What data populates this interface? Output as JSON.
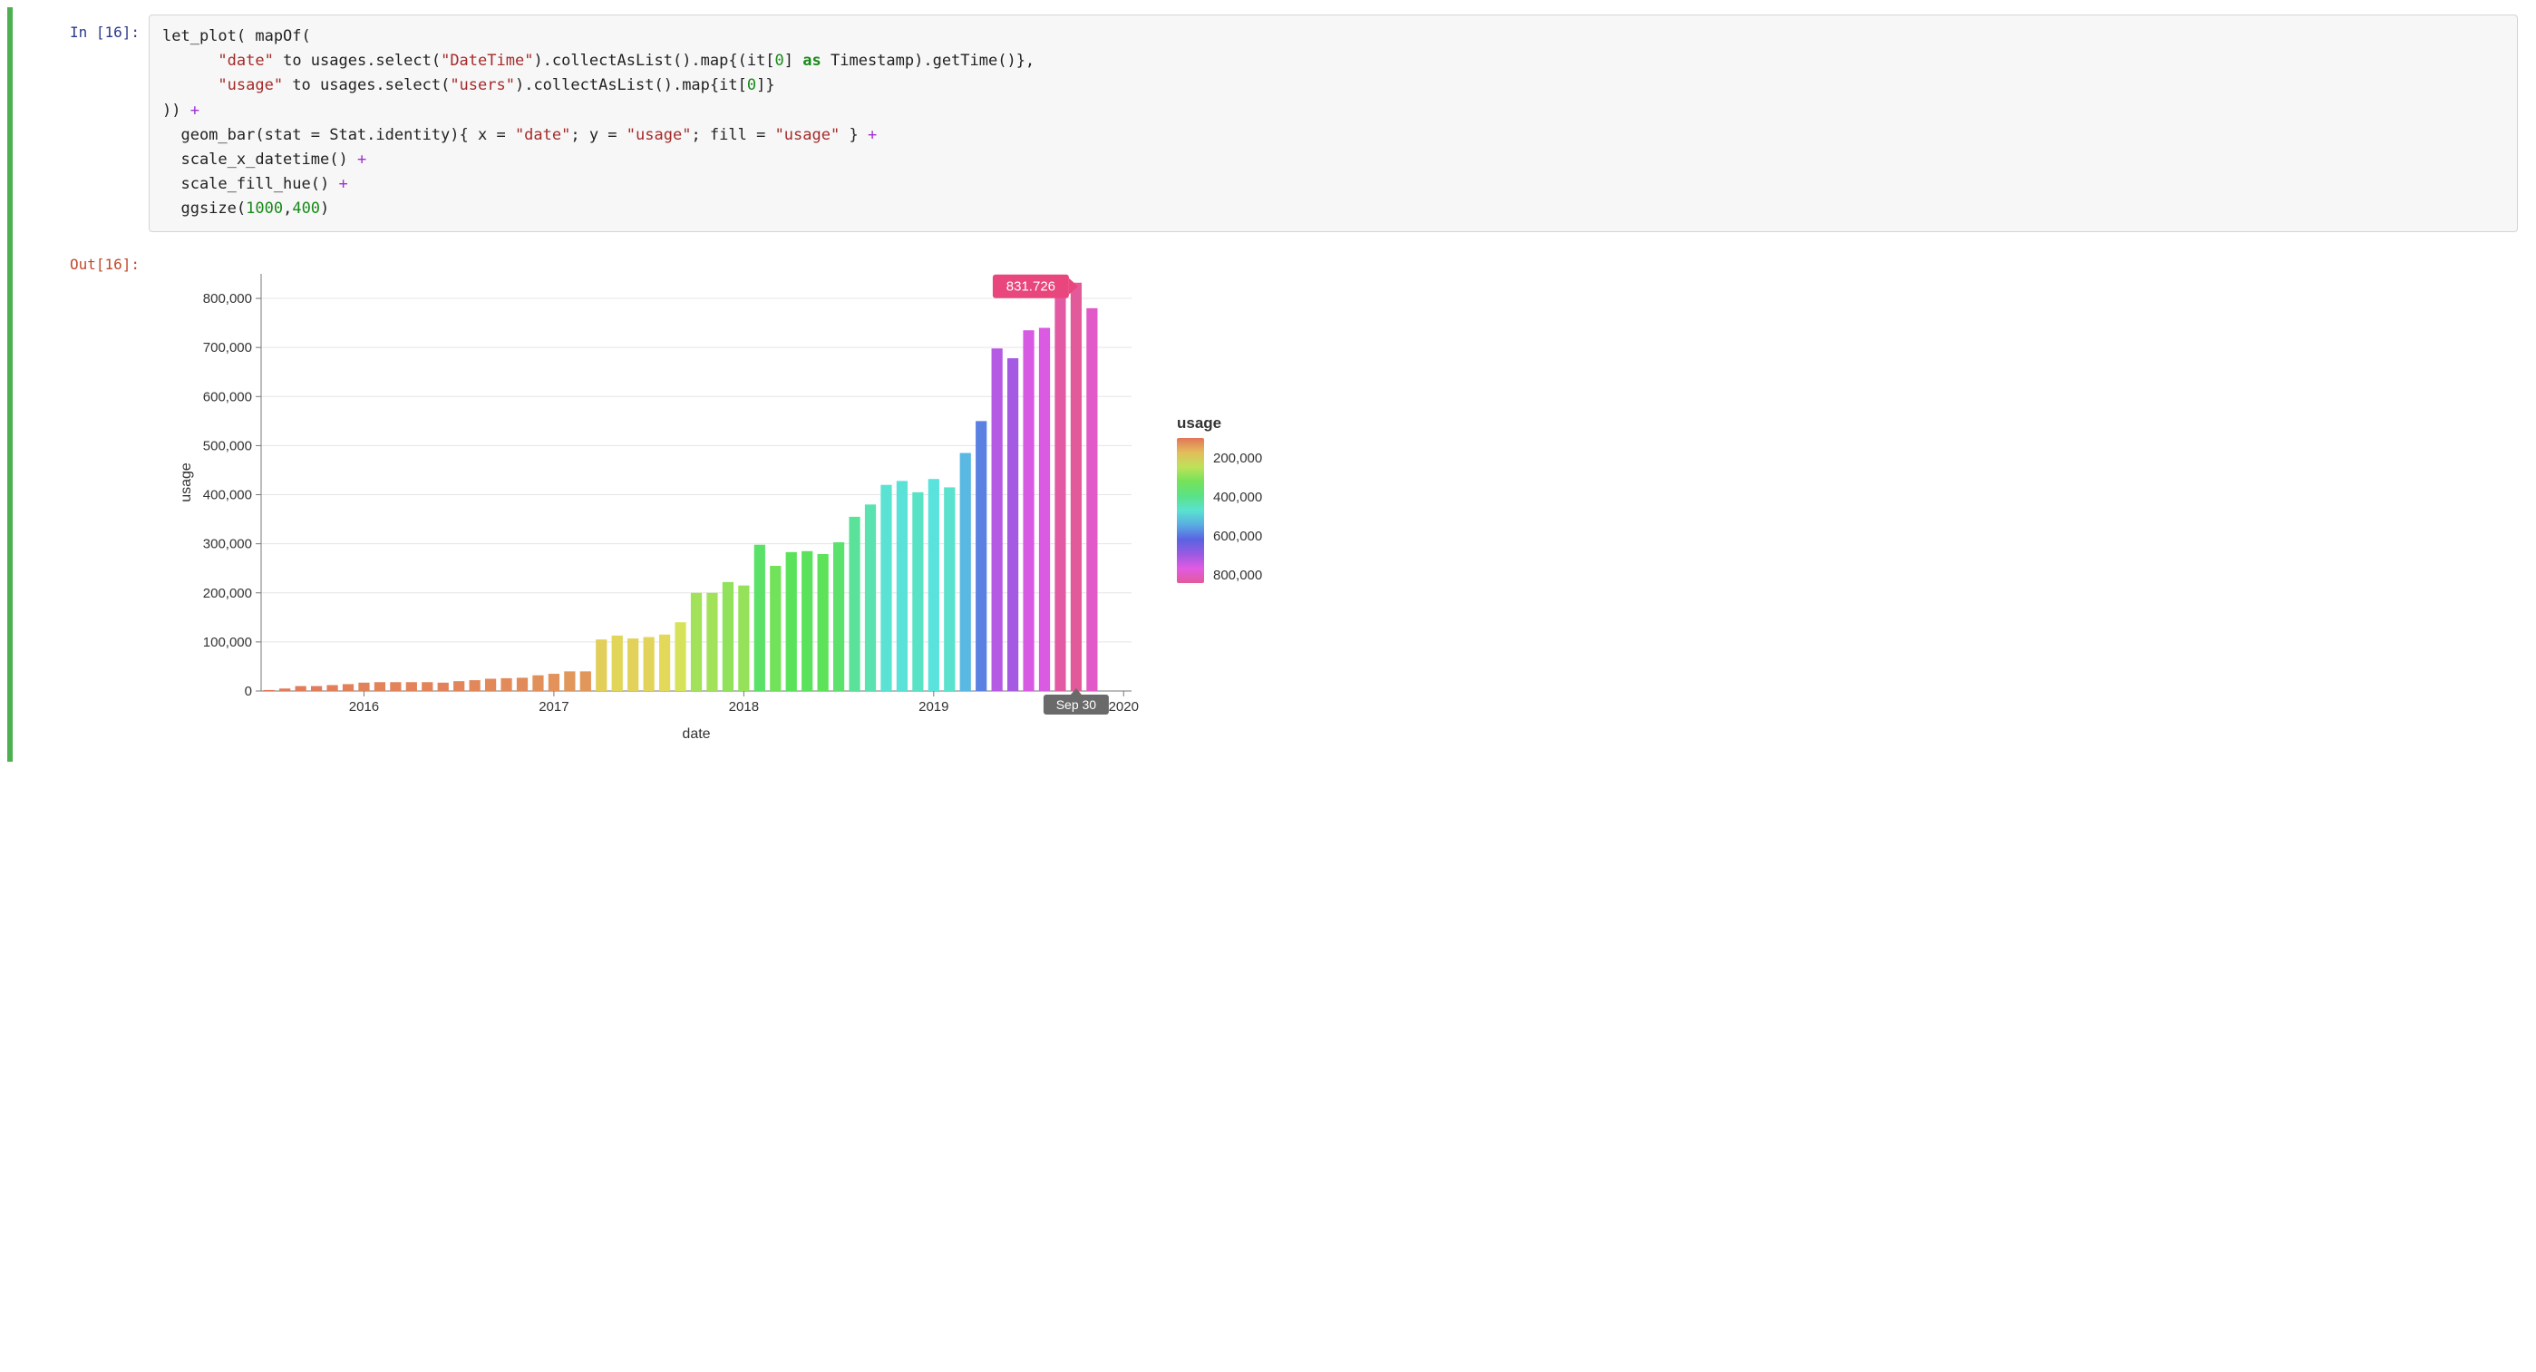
{
  "input_prompt": "In [16]:",
  "output_prompt": "Out[16]:",
  "code": {
    "l1a": "let_plot( mapOf(",
    "l2a": "      ",
    "l2s1": "\"date\"",
    "l2b": " to usages.select(",
    "l2s2": "\"DateTime\"",
    "l2c": ").collectAsList().map{(it[",
    "l2n1": "0",
    "l2d": "] ",
    "l2kw": "as",
    "l2e": " Timestamp).getTime()},",
    "l3a": "      ",
    "l3s1": "\"usage\"",
    "l3b": " to usages.select(",
    "l3s2": "\"users\"",
    "l3c": ").collectAsList().map{it[",
    "l3n1": "0",
    "l3d": "]}",
    "l4a": ")) ",
    "l4op": "+",
    "l5a": "  geom_bar(stat = Stat.identity){ x = ",
    "l5s1": "\"date\"",
    "l5b": "; y = ",
    "l5s2": "\"usage\"",
    "l5c": "; fill = ",
    "l5s3": "\"usage\"",
    "l5d": " } ",
    "l5op": "+",
    "l6a": "  scale_x_datetime() ",
    "l6op": "+",
    "l7a": "  scale_fill_hue() ",
    "l7op": "+",
    "l8a": "  ggsize(",
    "l8n1": "1000",
    "l8b": ",",
    "l8n2": "400",
    "l8c": ")"
  },
  "chart_data": {
    "type": "bar",
    "xlabel": "date",
    "ylabel": "usage",
    "ylim": [
      0,
      850000
    ],
    "y_ticks": [
      0,
      100000,
      200000,
      300000,
      400000,
      500000,
      600000,
      700000,
      800000
    ],
    "y_tick_labels": [
      "0",
      "100,000",
      "200,000",
      "300,000",
      "400,000",
      "500,000",
      "600,000",
      "700,000",
      "800,000"
    ],
    "x_year_ticks": [
      "2016",
      "2017",
      "2018",
      "2019",
      "2020"
    ],
    "tooltip_value": "831.726",
    "tooltip_x": "Sep 30",
    "legend": {
      "title": "usage",
      "ticks": [
        "200,000",
        "400,000",
        "600,000",
        "800,000"
      ]
    },
    "series": [
      {
        "date": "2015-07",
        "value": 2000
      },
      {
        "date": "2015-08",
        "value": 5000
      },
      {
        "date": "2015-09",
        "value": 10000
      },
      {
        "date": "2015-10",
        "value": 10000
      },
      {
        "date": "2015-11",
        "value": 12000
      },
      {
        "date": "2015-12",
        "value": 14000
      },
      {
        "date": "2016-01",
        "value": 17000
      },
      {
        "date": "2016-02",
        "value": 18000
      },
      {
        "date": "2016-03",
        "value": 18000
      },
      {
        "date": "2016-04",
        "value": 18000
      },
      {
        "date": "2016-05",
        "value": 18000
      },
      {
        "date": "2016-06",
        "value": 17000
      },
      {
        "date": "2016-07",
        "value": 20000
      },
      {
        "date": "2016-08",
        "value": 22000
      },
      {
        "date": "2016-09",
        "value": 25000
      },
      {
        "date": "2016-10",
        "value": 26000
      },
      {
        "date": "2016-11",
        "value": 27000
      },
      {
        "date": "2016-12",
        "value": 32000
      },
      {
        "date": "2017-01",
        "value": 35000
      },
      {
        "date": "2017-02",
        "value": 40000
      },
      {
        "date": "2017-03",
        "value": 40000
      },
      {
        "date": "2017-04",
        "value": 105000
      },
      {
        "date": "2017-05",
        "value": 113000
      },
      {
        "date": "2017-06",
        "value": 107000
      },
      {
        "date": "2017-07",
        "value": 110000
      },
      {
        "date": "2017-08",
        "value": 115000
      },
      {
        "date": "2017-09",
        "value": 140000
      },
      {
        "date": "2017-10",
        "value": 200000
      },
      {
        "date": "2017-11",
        "value": 200000
      },
      {
        "date": "2017-12",
        "value": 222000
      },
      {
        "date": "2018-01",
        "value": 215000
      },
      {
        "date": "2018-02",
        "value": 298000
      },
      {
        "date": "2018-03",
        "value": 255000
      },
      {
        "date": "2018-04",
        "value": 283000
      },
      {
        "date": "2018-05",
        "value": 285000
      },
      {
        "date": "2018-06",
        "value": 279000
      },
      {
        "date": "2018-07",
        "value": 303000
      },
      {
        "date": "2018-08",
        "value": 355000
      },
      {
        "date": "2018-09",
        "value": 380000
      },
      {
        "date": "2018-10",
        "value": 420000
      },
      {
        "date": "2018-11",
        "value": 428000
      },
      {
        "date": "2018-12",
        "value": 405000
      },
      {
        "date": "2019-01",
        "value": 432000
      },
      {
        "date": "2019-02",
        "value": 415000
      },
      {
        "date": "2019-03",
        "value": 485000
      },
      {
        "date": "2019-04",
        "value": 550000
      },
      {
        "date": "2019-05",
        "value": 698000
      },
      {
        "date": "2019-06",
        "value": 678000
      },
      {
        "date": "2019-07",
        "value": 735000
      },
      {
        "date": "2019-08",
        "value": 740000
      },
      {
        "date": "2019-09",
        "value": 820000
      },
      {
        "date": "2019-10",
        "value": 832000
      },
      {
        "date": "2019-11",
        "value": 780000
      }
    ]
  }
}
